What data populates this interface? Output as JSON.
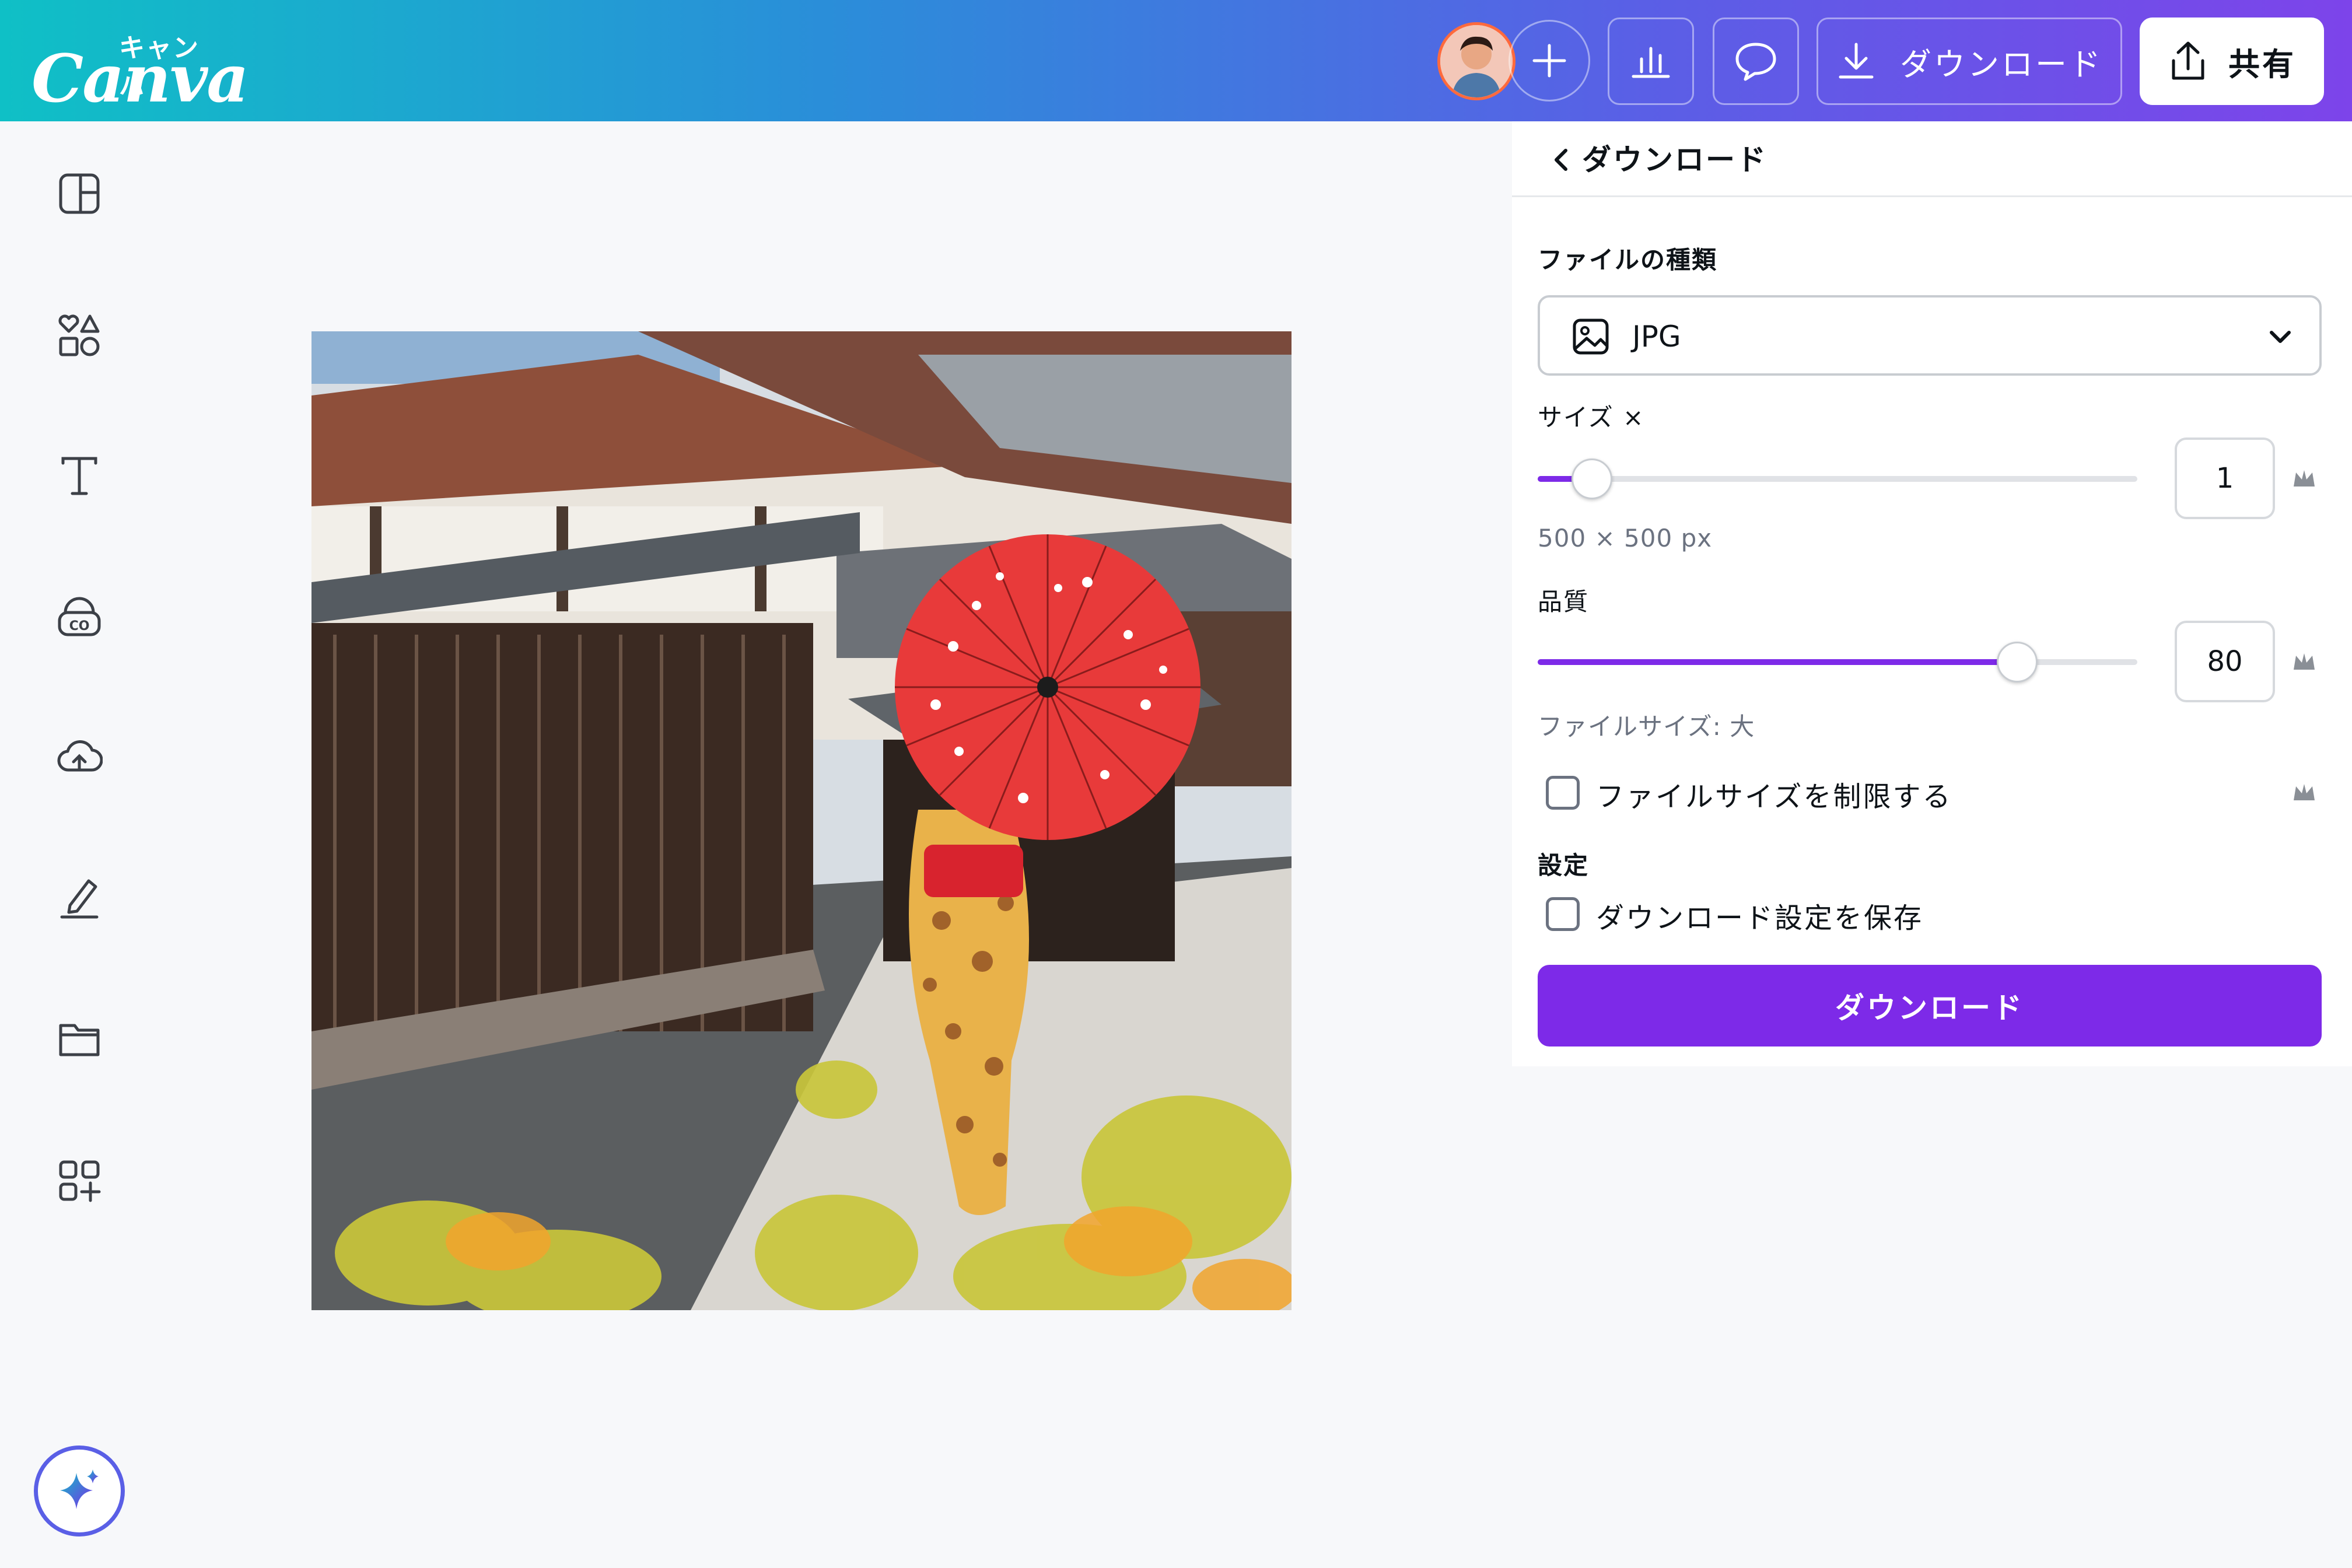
{
  "brand": {
    "kana": "キャンバ",
    "name": "Canva"
  },
  "toolbar": {
    "download_label": "ダウンロード",
    "share_label": "共有"
  },
  "panel": {
    "title": "ダウンロード",
    "file_type_label": "ファイルの種類",
    "file_type_value": "JPG",
    "size_label": "サイズ ×",
    "size_value": "1",
    "size_fraction": 0.09,
    "size_dims": "500 × 500 px",
    "quality_label": "品質",
    "quality_value": "80",
    "quality_fraction": 0.8,
    "file_size_hint": "ファイルサイズ: 大",
    "limit_size_label": "ファイルサイズを制限する",
    "limit_size_checked": false,
    "settings_label": "設定",
    "save_settings_label": "ダウンロード設定を保存",
    "save_settings_checked": false,
    "download_button": "ダウンロード"
  },
  "sidebar": {
    "icons": [
      "layout-icon",
      "elements-icon",
      "text-icon",
      "brand-icon",
      "uploads-icon",
      "draw-icon",
      "projects-icon",
      "apps-icon"
    ]
  },
  "colors": {
    "accent": "#7d2ae8",
    "gradient_start": "#0fc0c6",
    "gradient_end": "#7d44ea"
  }
}
